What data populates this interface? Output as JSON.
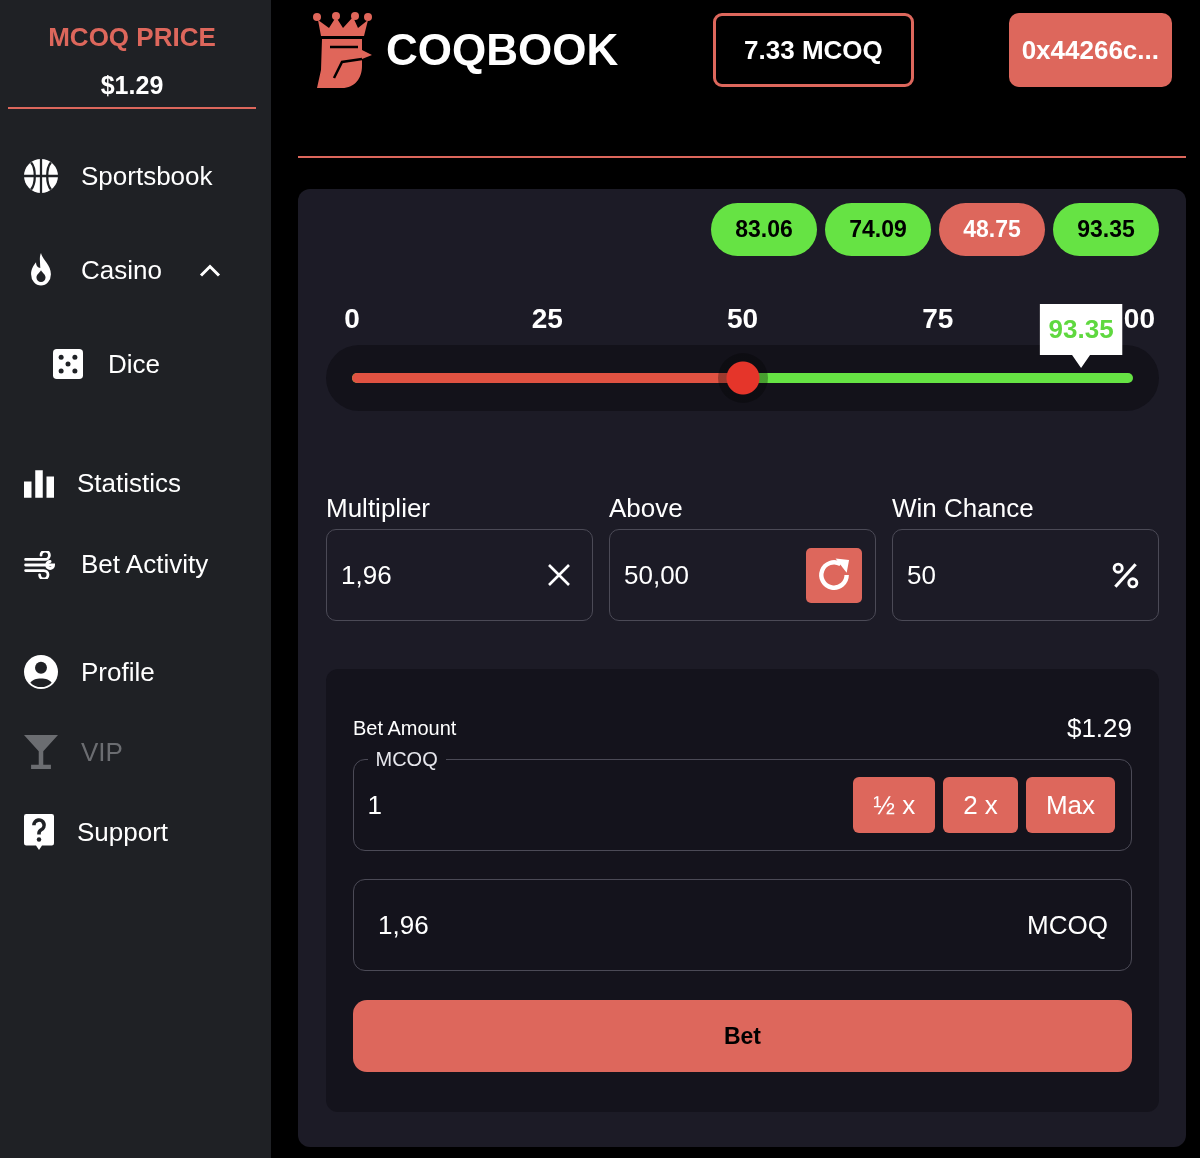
{
  "sidebar": {
    "price_title": "MCOQ PRICE",
    "price": "$1.29",
    "sections": [
      {
        "items": [
          {
            "label": "Sportsbook",
            "disabled": false
          },
          {
            "label": "Casino",
            "disabled": false,
            "expanded": true,
            "children": [
              {
                "label": "Dice",
                "disabled": false
              }
            ]
          }
        ]
      },
      {
        "items": [
          {
            "label": "Statistics",
            "disabled": false
          },
          {
            "label": "Bet Activity",
            "disabled": false
          }
        ]
      },
      {
        "items": [
          {
            "label": "Profile",
            "disabled": false
          },
          {
            "label": "VIP",
            "disabled": true
          },
          {
            "label": "Support",
            "disabled": false
          }
        ]
      }
    ]
  },
  "header": {
    "logo_text": "COQBOOK",
    "balance": "7.33 MCOQ",
    "wallet": "0x44266c..."
  },
  "recent_results": [
    {
      "value": "83.06",
      "won": true
    },
    {
      "value": "74.09",
      "won": true
    },
    {
      "value": "48.75",
      "won": false
    },
    {
      "value": "93.35",
      "won": true
    }
  ],
  "slider": {
    "ticks": [
      "0",
      "25",
      "50",
      "75",
      "00"
    ],
    "level": 0.5,
    "marker": {
      "value": "93.35",
      "level": 0.9335,
      "won": true
    }
  },
  "fields": [
    {
      "label": "Multiplier",
      "value": "1,96",
      "kind": "clear"
    },
    {
      "label": "Above",
      "value": "50,00",
      "kind": "refresh"
    },
    {
      "label": "Win Chance",
      "value": "50",
      "kind": "percent"
    }
  ],
  "bet_panel": {
    "title": "Bet Amount",
    "usd_value": "$1.29",
    "amount": {
      "label": "MCOQ",
      "value": "1",
      "buttons": [
        "½ x",
        "2 x",
        "Max"
      ]
    },
    "second_field": {
      "value": "1,96",
      "unit": "MCOQ"
    },
    "submit": "Bet"
  }
}
